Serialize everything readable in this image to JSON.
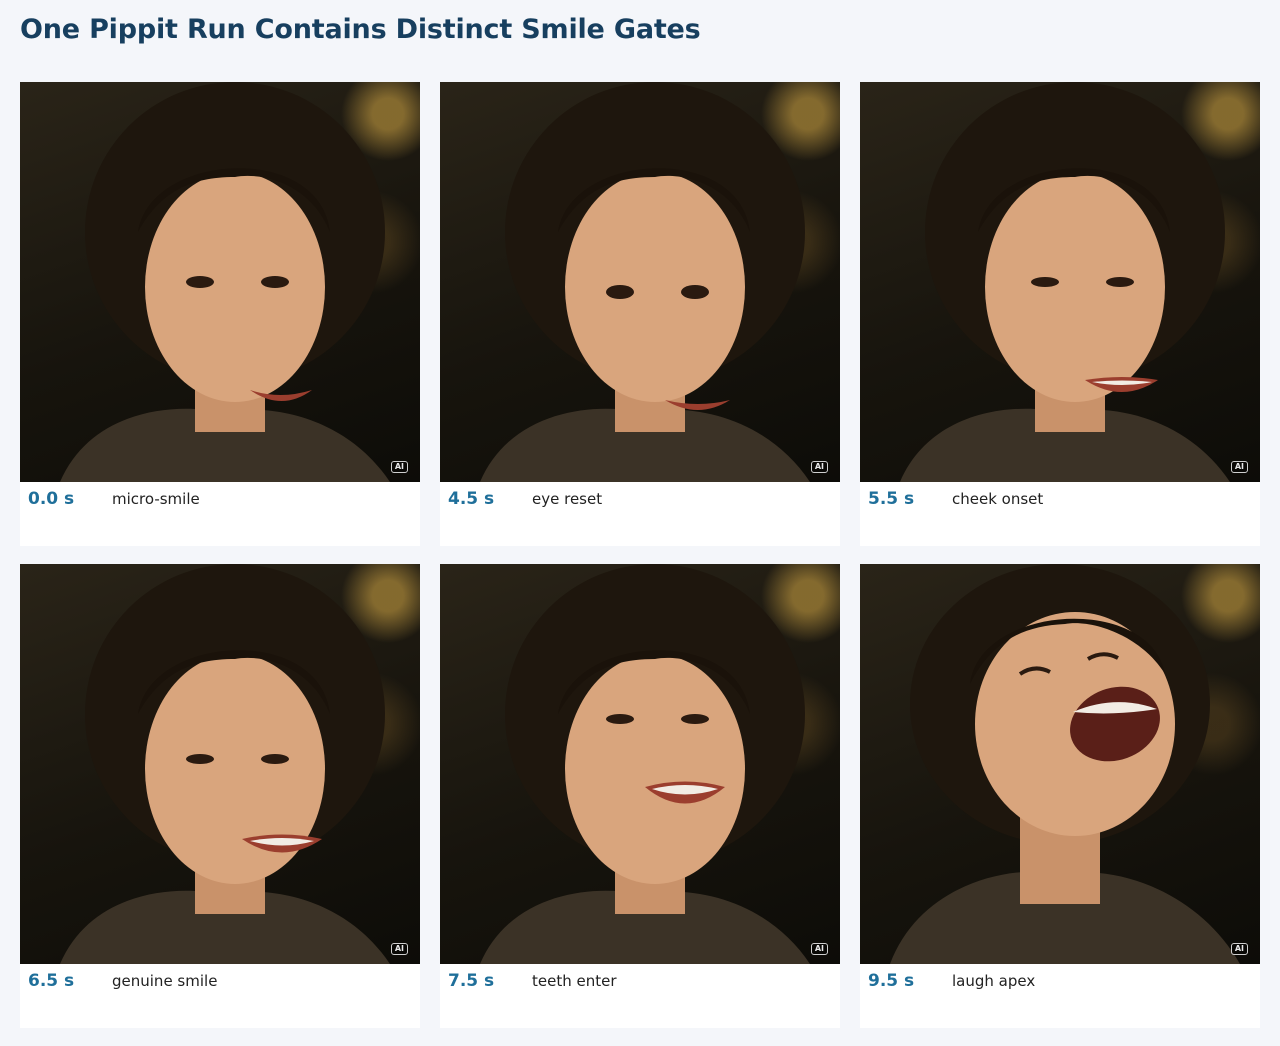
{
  "page": {
    "title": "One Pippit Run Contains Distinct Smile Gates"
  },
  "colors": {
    "title": "#173f5f",
    "time": "#1f6f9a",
    "background": "#f4f6fa",
    "card": "#ffffff"
  },
  "frames": [
    {
      "time": "0.0 s",
      "label": "micro-smile",
      "badge": "AI",
      "expression": "micro-smile"
    },
    {
      "time": "4.5 s",
      "label": "eye reset",
      "badge": "AI",
      "expression": "soft-smile"
    },
    {
      "time": "5.5 s",
      "label": "cheek onset",
      "badge": "AI",
      "expression": "smile"
    },
    {
      "time": "6.5 s",
      "label": "genuine smile",
      "badge": "AI",
      "expression": "smile"
    },
    {
      "time": "7.5 s",
      "label": "teeth enter",
      "badge": "AI",
      "expression": "teeth"
    },
    {
      "time": "9.5 s",
      "label": "laugh apex",
      "badge": "AI",
      "expression": "laugh"
    }
  ]
}
